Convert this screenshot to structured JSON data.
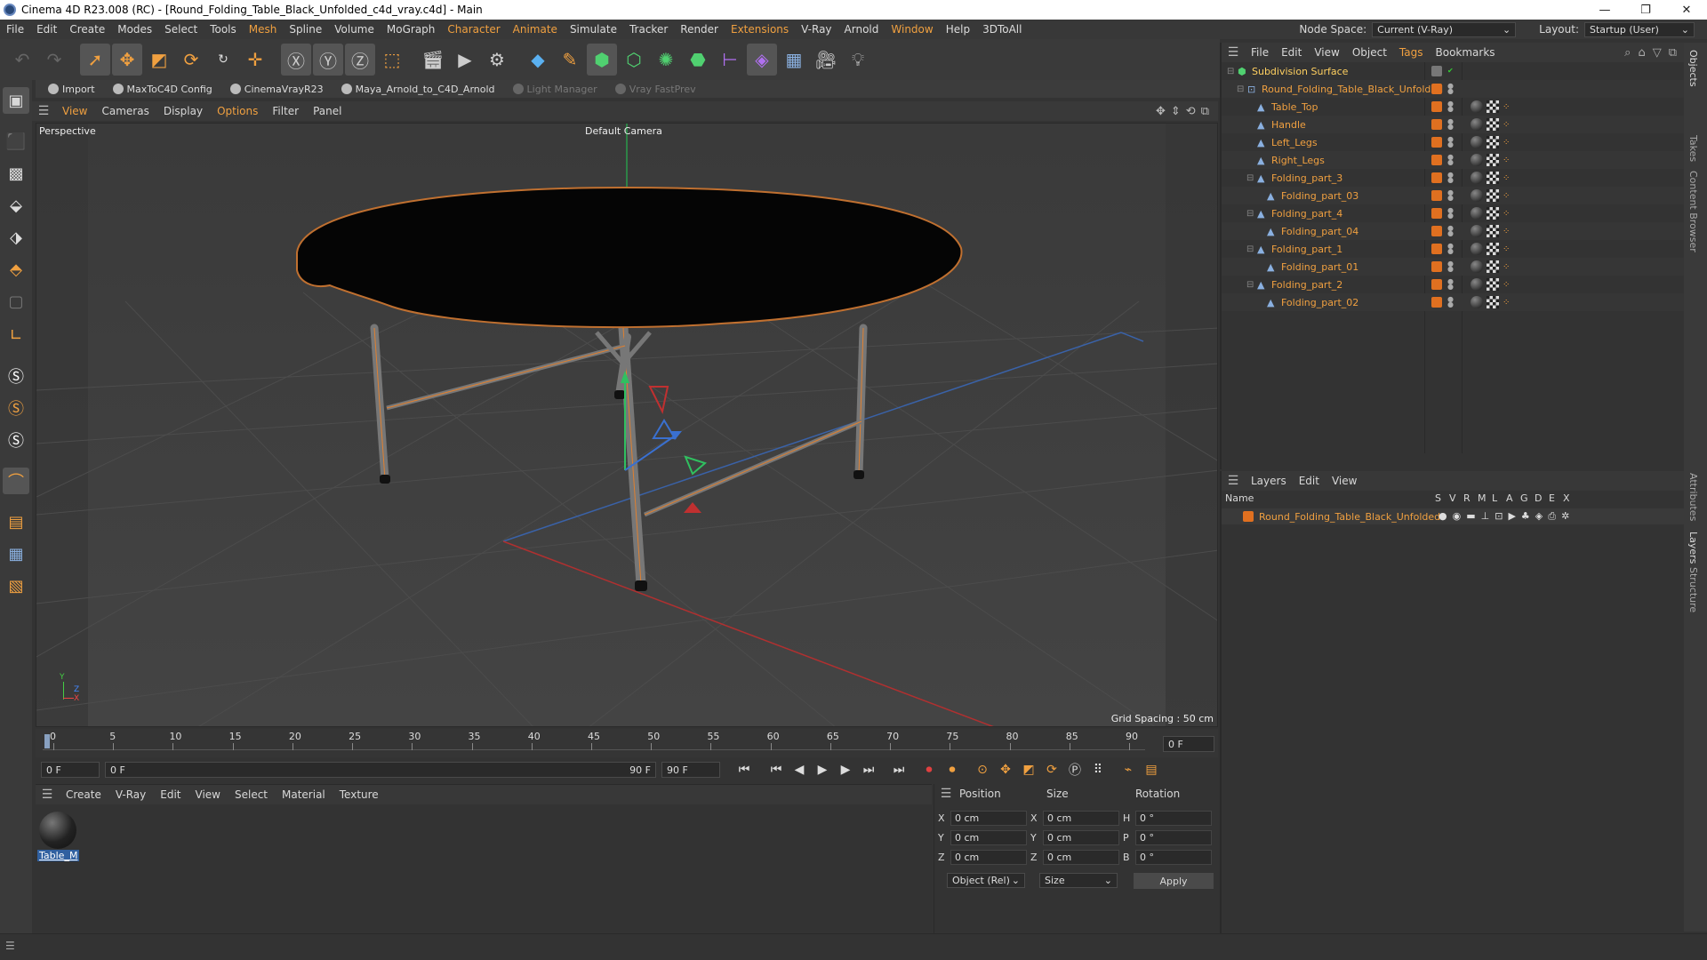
{
  "titlebar": {
    "title": "Cinema 4D R23.008 (RC) - [Round_Folding_Table_Black_Unfolded_c4d_vray.c4d] - Main",
    "min": "—",
    "max": "❐",
    "close": "✕"
  },
  "menubar": {
    "items": [
      "File",
      "Edit",
      "Create",
      "Modes",
      "Select",
      "Tools",
      "Mesh",
      "Spline",
      "Volume",
      "MoGraph",
      "Character",
      "Animate",
      "Simulate",
      "Tracker",
      "Render",
      "Extensions",
      "V-Ray",
      "Arnold",
      "Window",
      "Help",
      "3DToAll"
    ],
    "node_space_label": "Node Space:",
    "node_space_value": "Current (V-Ray)",
    "layout_label": "Layout:",
    "layout_value": "Startup (User)"
  },
  "pluginbar": {
    "items": [
      {
        "label": "Import",
        "dim": false
      },
      {
        "label": "MaxToC4D Config",
        "dim": false
      },
      {
        "label": "CinemaVrayR23",
        "dim": false
      },
      {
        "label": "Maya_Arnold_to_C4D_Arnold",
        "dim": false
      },
      {
        "label": "Light Manager",
        "dim": true
      },
      {
        "label": "Vray FastPrev",
        "dim": true
      }
    ]
  },
  "viewport": {
    "menu": [
      "View",
      "Cameras",
      "Display",
      "Options",
      "Filter",
      "Panel"
    ],
    "mode_label": "Perspective",
    "camera_label": "Default Camera",
    "grid_spacing": "Grid Spacing : 50 cm",
    "axis_y": "Y",
    "axis_z": "Z",
    "axis_x": "X"
  },
  "timeline": {
    "ticks": [
      "0",
      "5",
      "10",
      "15",
      "20",
      "25",
      "30",
      "35",
      "40",
      "45",
      "50",
      "55",
      "60",
      "65",
      "70",
      "75",
      "80",
      "85",
      "90"
    ],
    "current_frame_right": "0 F",
    "start_field": "0 F",
    "range_start": "0 F",
    "range_end": "90 F",
    "end_field": "90 F"
  },
  "material_panel": {
    "menu": [
      "Create",
      "V-Ray",
      "Edit",
      "View",
      "Select",
      "Material",
      "Texture"
    ],
    "materials": [
      {
        "name": "Table_M"
      }
    ]
  },
  "coords": {
    "headers": [
      "Position",
      "Size",
      "Rotation"
    ],
    "rows": [
      {
        "axis": "X",
        "pos": "0 cm",
        "size_axis": "X",
        "size": "0 cm",
        "rot_axis": "H",
        "rot": "0 °"
      },
      {
        "axis": "Y",
        "pos": "0 cm",
        "size_axis": "Y",
        "size": "0 cm",
        "rot_axis": "P",
        "rot": "0 °"
      },
      {
        "axis": "Z",
        "pos": "0 cm",
        "size_axis": "Z",
        "size": "0 cm",
        "rot_axis": "B",
        "rot": "0 °"
      }
    ],
    "mode_select": "Object (Rel)",
    "size_select": "Size",
    "apply_label": "Apply"
  },
  "object_manager": {
    "menu": [
      "File",
      "Edit",
      "View",
      "Object",
      "Tags",
      "Bookmarks"
    ],
    "objects": [
      {
        "name": "Subdivision Surface",
        "level": 0,
        "white": true
      },
      {
        "name": "Round_Folding_Table_Black_Unfolded",
        "level": 1
      },
      {
        "name": "Table_Top",
        "level": 2
      },
      {
        "name": "Handle",
        "level": 2
      },
      {
        "name": "Left_Legs",
        "level": 2
      },
      {
        "name": "Right_Legs",
        "level": 2
      },
      {
        "name": "Folding_part_3",
        "level": 2
      },
      {
        "name": "Folding_part_03",
        "level": 3
      },
      {
        "name": "Folding_part_4",
        "level": 2
      },
      {
        "name": "Folding_part_04",
        "level": 3
      },
      {
        "name": "Folding_part_1",
        "level": 2
      },
      {
        "name": "Folding_part_01",
        "level": 3
      },
      {
        "name": "Folding_part_2",
        "level": 2
      },
      {
        "name": "Folding_part_02",
        "level": 3
      }
    ]
  },
  "layer_manager": {
    "menu": [
      "Layers",
      "Edit",
      "View"
    ],
    "columns": [
      "Name",
      "S",
      "V",
      "R",
      "M",
      "L",
      "A",
      "G",
      "D",
      "E",
      "X"
    ],
    "layers": [
      {
        "name": "Round_Folding_Table_Black_Unfolded"
      }
    ]
  },
  "side_tabs": [
    "Objects",
    "Takes",
    "Content Browser",
    "Attributes",
    "Layers",
    "Structure"
  ],
  "colors": {
    "accent": "#f0a040",
    "layer_orange": "#e07020",
    "bg": "#333333"
  }
}
